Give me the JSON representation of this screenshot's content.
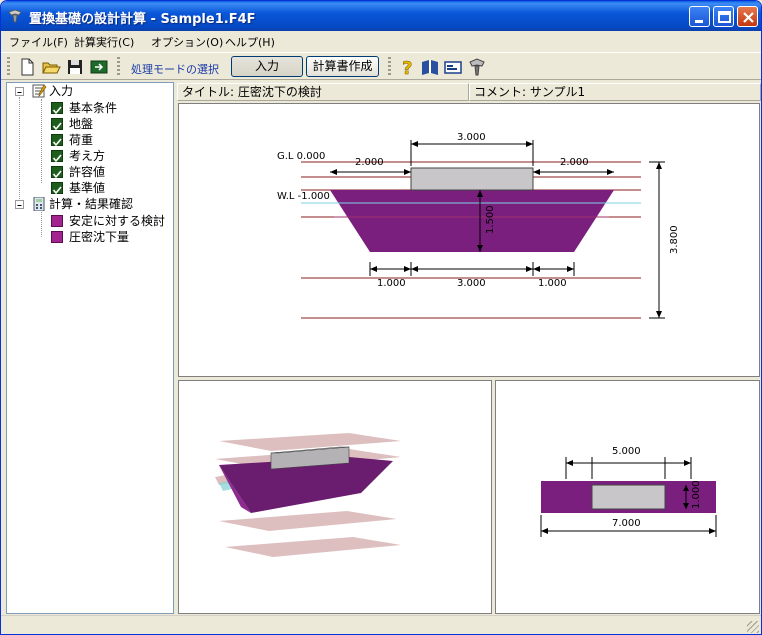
{
  "window": {
    "title": "置換基礎の設計計算 - Sample1.F4F"
  },
  "menu": [
    {
      "label": "ファイル(F)"
    },
    {
      "label": "計算実行(C)"
    },
    {
      "label": "オプション(O)"
    },
    {
      "label": "ヘルプ(H)"
    }
  ],
  "toolbar": {
    "mode_label": "処理モードの選択",
    "input_button": "入力",
    "report_button": "計算書作成",
    "icons": [
      "new-file-icon",
      "open-folder-icon",
      "save-disk-icon",
      "export-icon",
      "help-icon",
      "book-icon",
      "card-icon",
      "tool-icon"
    ]
  },
  "tree": {
    "input_root": "入力",
    "input_items": [
      "基本条件",
      "地盤",
      "荷重",
      "考え方",
      "許容値",
      "基準値"
    ],
    "calc_root": "計算・結果確認",
    "calc_items": [
      "安定に対する検討",
      "圧密沈下量"
    ]
  },
  "info": {
    "title": "タイトル: 圧密沈下の検討",
    "comment": "コメント: サンプル1"
  },
  "section_view": {
    "gl_label": "G.L 0.000",
    "wl_label": "W.L -1.000",
    "top_width": "3.000",
    "left_ext": "2.000",
    "right_ext": "2.000",
    "depth": "1.500",
    "total_depth": "3.800",
    "bottom_left": "1.000",
    "bottom_mid": "3.000",
    "bottom_right": "1.000"
  },
  "plan_view": {
    "width_top": "5.000",
    "width_total": "7.000",
    "height": "1.000"
  },
  "colors": {
    "fill_purple": "#7b1f7f",
    "footing_gray": "#c8c6c8",
    "layer_line": "#8a1e1e",
    "water_line": "#7ed3e6"
  }
}
